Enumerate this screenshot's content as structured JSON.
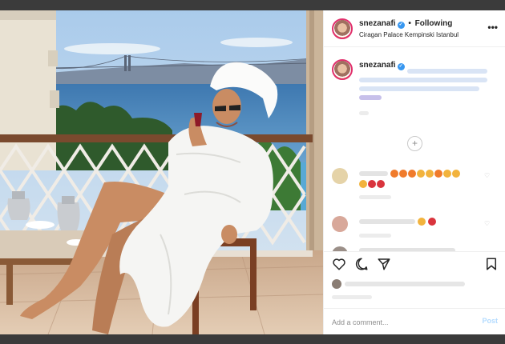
{
  "post": {
    "username": "snezanafi",
    "separator": "•",
    "follow_status": "Following",
    "location": "Ciragan Palace Kempinski Istanbul",
    "more_glyph": "•••",
    "load_more_glyph": "+",
    "verified_glyph": "✓"
  },
  "comment_box": {
    "placeholder": "Add a comment...",
    "post_label": "Post"
  },
  "icons": [
    "heart-icon",
    "comment-icon",
    "share-icon",
    "bookmark-icon",
    "verified-icon",
    "more-icon",
    "load-more-icon"
  ],
  "colors": {
    "accent_blue": "#3897f0",
    "post_disabled": "#b3dbff",
    "story_ring": "#e1306c",
    "backdrop": "#3b3b3b"
  }
}
